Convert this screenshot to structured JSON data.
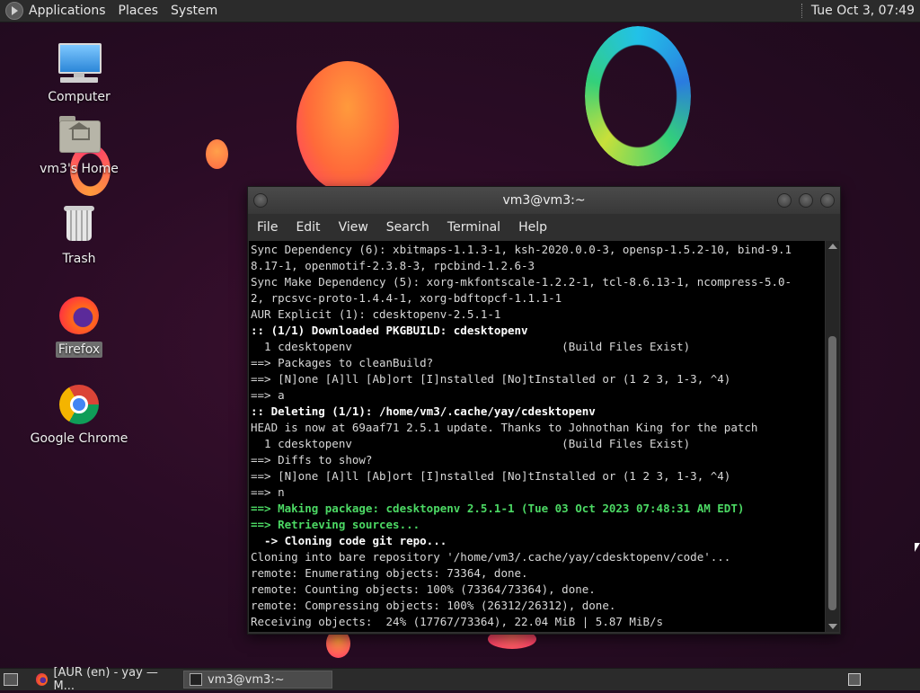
{
  "top_panel": {
    "menus": [
      "Applications",
      "Places",
      "System"
    ],
    "clock": "Tue Oct  3, 07:49"
  },
  "desktop_icons": [
    {
      "label": "Computer",
      "icon": "computer-icon"
    },
    {
      "label": "vm3's Home",
      "icon": "home-folder-icon"
    },
    {
      "label": "Trash",
      "icon": "trash-icon"
    },
    {
      "label": "Firefox",
      "icon": "firefox-icon"
    },
    {
      "label": "Google Chrome",
      "icon": "chrome-icon"
    }
  ],
  "terminal": {
    "title": "vm3@vm3:~",
    "menu": [
      "File",
      "Edit",
      "View",
      "Search",
      "Terminal",
      "Help"
    ],
    "lines": [
      "Sync Dependency (6): xbitmaps-1.1.3-1, ksh-2020.0.0-3, opensp-1.5.2-10, bind-9.1",
      "8.17-1, openmotif-2.3.8-3, rpcbind-1.2.6-3",
      "Sync Make Dependency (5): xorg-mkfontscale-1.2.2-1, tcl-8.6.13-1, ncompress-5.0-",
      "2, rpcsvc-proto-1.4.4-1, xorg-bdftopcf-1.1.1-1",
      "AUR Explicit (1): cdesktopenv-2.5.1-1",
      ":: (1/1) Downloaded PKGBUILD: cdesktopenv",
      "  1 cdesktopenv                               (Build Files Exist)",
      "==> Packages to cleanBuild?",
      "==> [N]one [A]ll [Ab]ort [I]nstalled [No]tInstalled or (1 2 3, 1-3, ^4)",
      "==> a",
      ":: Deleting (1/1): /home/vm3/.cache/yay/cdesktopenv",
      "HEAD is now at 69aaf71 2.5.1 update. Thanks to Johnothan King for the patch",
      "  1 cdesktopenv                               (Build Files Exist)",
      "==> Diffs to show?",
      "==> [N]one [A]ll [Ab]ort [I]nstalled [No]tInstalled or (1 2 3, 1-3, ^4)",
      "==> n",
      "==> Making package: cdesktopenv 2.5.1-1 (Tue 03 Oct 2023 07:48:31 AM EDT)",
      "==> Retrieving sources...",
      "  -> Cloning code git repo...",
      "Cloning into bare repository '/home/vm3/.cache/yay/cdesktopenv/code'...",
      "remote: Enumerating objects: 73364, done.",
      "remote: Counting objects: 100% (73364/73364), done.",
      "remote: Compressing objects: 100% (26312/26312), done.",
      "Receiving objects:  24% (17767/73364), 22.04 MiB | 5.87 MiB/s"
    ]
  },
  "taskbar": {
    "tasks": [
      {
        "label": "[AUR (en) - yay — M...",
        "icon": "firefox-icon",
        "active": false
      },
      {
        "label": "vm3@vm3:~",
        "icon": "terminal-icon",
        "active": true
      }
    ]
  }
}
